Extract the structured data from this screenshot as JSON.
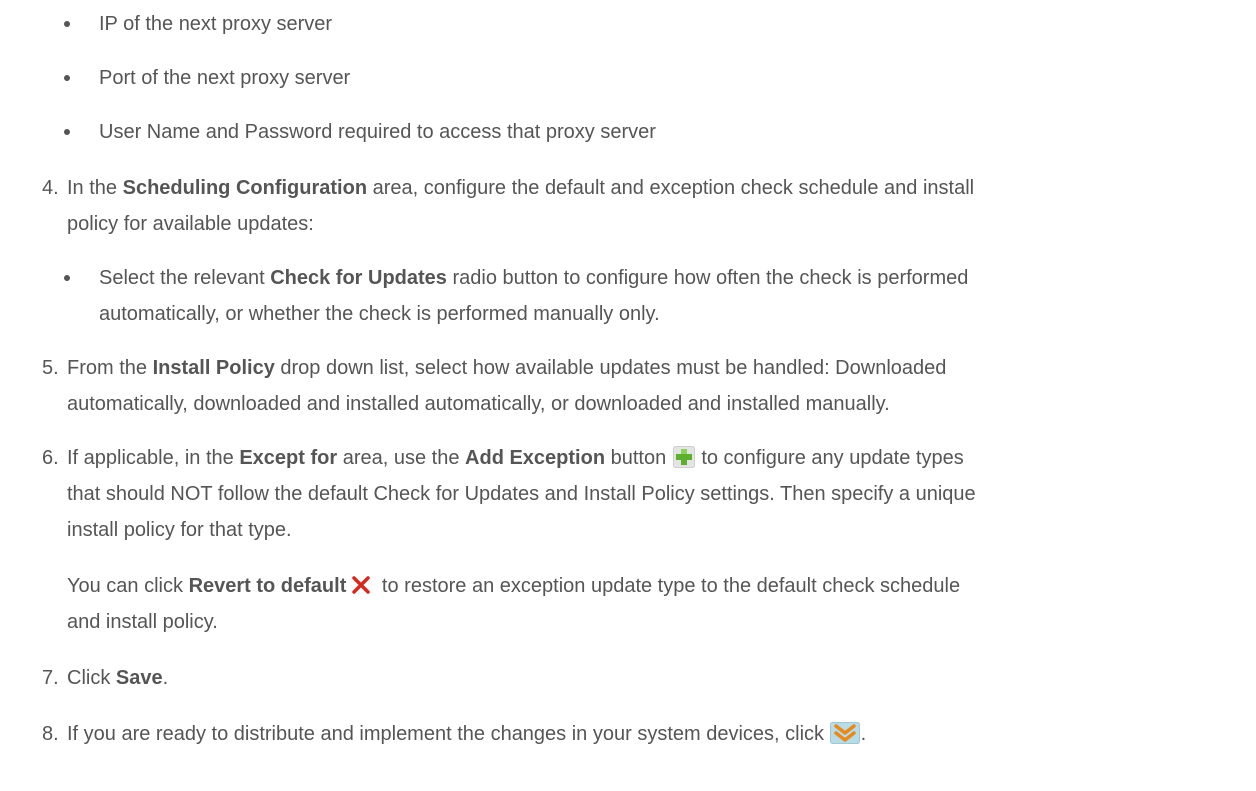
{
  "bullets_top": [
    "IP of the next proxy server",
    "Port of the next proxy server",
    "User Name and Password required to access that proxy server"
  ],
  "step4": {
    "number": "4.",
    "pre": "In the ",
    "bold": "Scheduling Configuration",
    "post": " area, configure the default and exception check schedule and install",
    "line2": "policy for available updates:",
    "bullet": {
      "pre": "Select the relevant ",
      "bold": "Check for Updates",
      "post": " radio button to configure how often the check is performed",
      "line2": "automatically, or whether the check is performed manually only."
    }
  },
  "step5": {
    "number": "5.",
    "pre": "From the ",
    "bold": "Install Policy",
    "post": " drop down list, select how available updates must be handled: Downloaded",
    "line2": "automatically, downloaded and installed automatically, or downloaded and installed manually."
  },
  "step6": {
    "number": "6.",
    "pre": "If applicable, in the ",
    "bold1": "Except for",
    "mid1": " area, use the ",
    "bold2": "Add Exception",
    "mid2": " button ",
    "post": " to configure any update types",
    "line2": "that should NOT follow the default Check for Updates and Install Policy settings. Then specify a unique",
    "line3": "install policy for that type.",
    "note_pre": "You can click ",
    "note_bold": "Revert to default",
    "note_post": " to restore an exception update type to the default check schedule",
    "note_line2": "and install policy."
  },
  "step7": {
    "number": "7.",
    "pre": "Click ",
    "bold": "Save",
    "post": "."
  },
  "step8": {
    "number": "8.",
    "pre": "If you are ready to distribute and implement the changes in your system devices, click ",
    "post": "."
  },
  "icons": {
    "add_exception": "add-plus-icon",
    "revert": "red-x-icon",
    "distribute": "double-chevron-down-icon"
  }
}
